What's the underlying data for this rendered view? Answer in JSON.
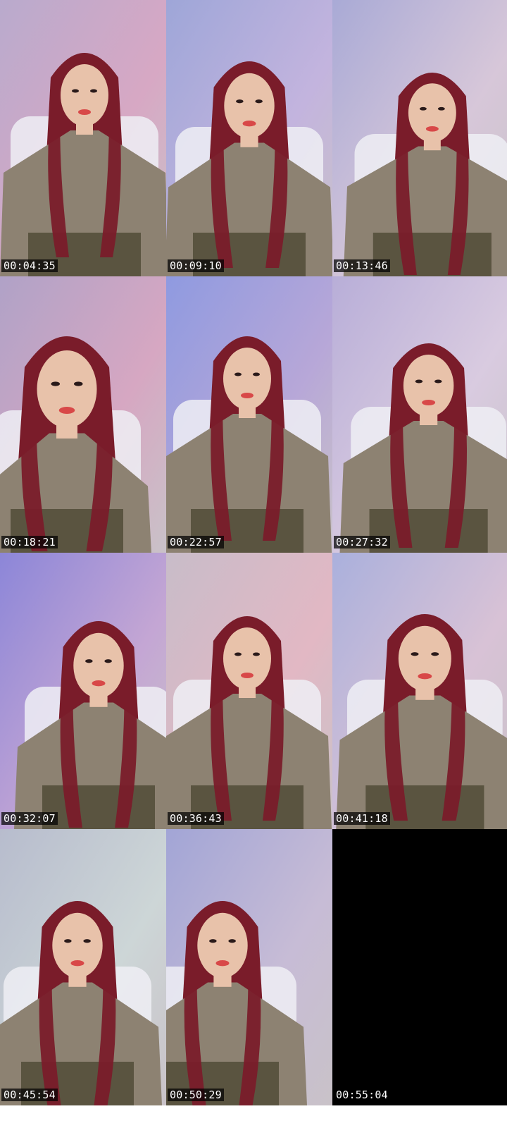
{
  "contact_sheet": {
    "frames": [
      {
        "timestamp": "00:04:35",
        "bg": "#b9aacd",
        "tint": "#d7a8c4"
      },
      {
        "timestamp": "00:09:10",
        "bg": "#9ea6d8",
        "tint": "#c3b4de"
      },
      {
        "timestamp": "00:13:46",
        "bg": "#a9aad6",
        "tint": "#d7c7d9"
      },
      {
        "timestamp": "00:18:21",
        "bg": "#b0a2c7",
        "tint": "#d6a7c2"
      },
      {
        "timestamp": "00:22:57",
        "bg": "#8f9ae0",
        "tint": "#b7a7d8"
      },
      {
        "timestamp": "00:27:32",
        "bg": "#b8aed8",
        "tint": "#d9cbe0"
      },
      {
        "timestamp": "00:32:07",
        "bg": "#8c86d8",
        "tint": "#c4a6d4"
      },
      {
        "timestamp": "00:36:43",
        "bg": "#c8bcc9",
        "tint": "#e2b8c4"
      },
      {
        "timestamp": "00:41:18",
        "bg": "#aab0dc",
        "tint": "#d8c2d6"
      },
      {
        "timestamp": "00:45:54",
        "bg": "#b7bccd",
        "tint": "#cdd6d7"
      },
      {
        "timestamp": "00:50:29",
        "bg": "#a2a5d6",
        "tint": "#c7bcd6"
      },
      {
        "timestamp": "00:55:04",
        "bg": "#000000",
        "tint": "#000000"
      }
    ],
    "colors": {
      "hair": "#7a1c2a",
      "skin": "#e8c2aa",
      "top": "#8d8272",
      "lips": "#d84848",
      "chair": "#eeeef4",
      "skirt": "#5a5440"
    }
  }
}
